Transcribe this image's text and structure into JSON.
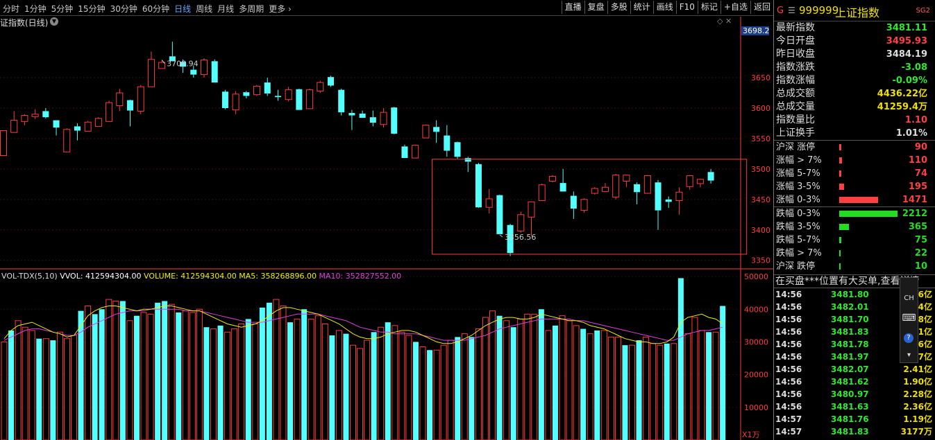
{
  "toolbar": {
    "periods": [
      "分时",
      "1分钟",
      "5分钟",
      "15分钟",
      "30分钟",
      "60分钟",
      "日线",
      "周线",
      "月线",
      "多周期",
      "更多 ›"
    ],
    "active_index": 6,
    "tools": [
      "直播",
      "复盘",
      "多股",
      "统计",
      "画线",
      "F10",
      "标记",
      "+自选",
      "返回"
    ]
  },
  "chart_title": "证指数(日线)",
  "colors": {
    "up": "#ff3c3c",
    "down": "#54ffff",
    "ma5": "#f0f000",
    "ma10": "#e040e0",
    "axis": "#ff3c3c",
    "text_up": "#ff4040",
    "text_down": "#2ee82e"
  },
  "chart_data": [
    {
      "type": "candlestick",
      "title": "证指数(日线)",
      "ylim": [
        3336,
        3732
      ],
      "y_ticks": [
        3350,
        3400,
        3450,
        3500,
        3550,
        3600,
        3650
      ],
      "last_price_label": "3698.2",
      "annotations": [
        {
          "text": "3708.94",
          "index": 15
        },
        {
          "text": "3356.56",
          "index": 47
        }
      ],
      "box": {
        "from_index": 41,
        "to_index": 70,
        "top": 3516,
        "bottom": 3360
      },
      "candles": [
        {
          "o": 3522,
          "h": 3563,
          "l": 3522,
          "c": 3563
        },
        {
          "o": 3560,
          "h": 3595,
          "l": 3560,
          "c": 3580
        },
        {
          "o": 3578,
          "h": 3590,
          "l": 3572,
          "c": 3588
        },
        {
          "o": 3586,
          "h": 3598,
          "l": 3582,
          "c": 3590
        },
        {
          "o": 3595,
          "h": 3600,
          "l": 3583,
          "c": 3585
        },
        {
          "o": 3580,
          "h": 3580,
          "l": 3555,
          "c": 3568
        },
        {
          "o": 3528,
          "h": 3567,
          "l": 3528,
          "c": 3565
        },
        {
          "o": 3570,
          "h": 3575,
          "l": 3547,
          "c": 3563
        },
        {
          "o": 3562,
          "h": 3579,
          "l": 3562,
          "c": 3577
        },
        {
          "o": 3570,
          "h": 3585,
          "l": 3570,
          "c": 3583
        },
        {
          "o": 3578,
          "h": 3612,
          "l": 3578,
          "c": 3609
        },
        {
          "o": 3604,
          "h": 3632,
          "l": 3595,
          "c": 3625
        },
        {
          "o": 3613,
          "h": 3614,
          "l": 3570,
          "c": 3596
        },
        {
          "o": 3595,
          "h": 3638,
          "l": 3590,
          "c": 3635
        },
        {
          "o": 3635,
          "h": 3693,
          "l": 3635,
          "c": 3680
        },
        {
          "o": 3665,
          "h": 3678,
          "l": 3665,
          "c": 3675
        },
        {
          "o": 3685,
          "h": 3709,
          "l": 3680,
          "c": 3677
        },
        {
          "o": 3676,
          "h": 3680,
          "l": 3658,
          "c": 3668
        },
        {
          "o": 3663,
          "h": 3670,
          "l": 3650,
          "c": 3655
        },
        {
          "o": 3655,
          "h": 3682,
          "l": 3650,
          "c": 3679
        },
        {
          "o": 3677,
          "h": 3680,
          "l": 3642,
          "c": 3642
        },
        {
          "o": 3627,
          "h": 3630,
          "l": 3598,
          "c": 3600
        },
        {
          "o": 3597,
          "h": 3628,
          "l": 3590,
          "c": 3623
        },
        {
          "o": 3626,
          "h": 3628,
          "l": 3616,
          "c": 3620
        },
        {
          "o": 3622,
          "h": 3638,
          "l": 3620,
          "c": 3636
        },
        {
          "o": 3642,
          "h": 3650,
          "l": 3620,
          "c": 3624
        },
        {
          "o": 3620,
          "h": 3630,
          "l": 3612,
          "c": 3618
        },
        {
          "o": 3614,
          "h": 3635,
          "l": 3611,
          "c": 3630
        },
        {
          "o": 3631,
          "h": 3632,
          "l": 3597,
          "c": 3597
        },
        {
          "o": 3599,
          "h": 3632,
          "l": 3599,
          "c": 3630
        },
        {
          "o": 3628,
          "h": 3645,
          "l": 3625,
          "c": 3642
        },
        {
          "o": 3651,
          "h": 3653,
          "l": 3635,
          "c": 3637
        },
        {
          "o": 3630,
          "h": 3632,
          "l": 3588,
          "c": 3593
        },
        {
          "o": 3592,
          "h": 3597,
          "l": 3564,
          "c": 3588
        },
        {
          "o": 3591,
          "h": 3596,
          "l": 3584,
          "c": 3584
        },
        {
          "o": 3585,
          "h": 3596,
          "l": 3570,
          "c": 3576
        },
        {
          "o": 3573,
          "h": 3600,
          "l": 3568,
          "c": 3593
        },
        {
          "o": 3601,
          "h": 3602,
          "l": 3557,
          "c": 3558
        },
        {
          "o": 3537,
          "h": 3540,
          "l": 3518,
          "c": 3518
        },
        {
          "o": 3518,
          "h": 3540,
          "l": 3518,
          "c": 3539
        },
        {
          "o": 3551,
          "h": 3573,
          "l": 3551,
          "c": 3572
        },
        {
          "o": 3569,
          "h": 3580,
          "l": 3543,
          "c": 3561
        },
        {
          "o": 3555,
          "h": 3572,
          "l": 3520,
          "c": 3530
        },
        {
          "o": 3544,
          "h": 3545,
          "l": 3517,
          "c": 3520
        },
        {
          "o": 3518,
          "h": 3520,
          "l": 3495,
          "c": 3512
        },
        {
          "o": 3508,
          "h": 3510,
          "l": 3436,
          "c": 3437
        },
        {
          "o": 3437,
          "h": 3467,
          "l": 3427,
          "c": 3451
        },
        {
          "o": 3457,
          "h": 3458,
          "l": 3393,
          "c": 3393
        },
        {
          "o": 3408,
          "h": 3410,
          "l": 3357,
          "c": 3362
        },
        {
          "o": 3398,
          "h": 3430,
          "l": 3395,
          "c": 3425
        },
        {
          "o": 3421,
          "h": 3446,
          "l": 3390,
          "c": 3446
        },
        {
          "o": 3448,
          "h": 3476,
          "l": 3448,
          "c": 3474
        },
        {
          "o": 3480,
          "h": 3490,
          "l": 3478,
          "c": 3488
        },
        {
          "o": 3477,
          "h": 3500,
          "l": 3465,
          "c": 3463
        },
        {
          "o": 3456,
          "h": 3463,
          "l": 3418,
          "c": 3435
        },
        {
          "o": 3432,
          "h": 3452,
          "l": 3428,
          "c": 3450
        },
        {
          "o": 3460,
          "h": 3470,
          "l": 3458,
          "c": 3468
        },
        {
          "o": 3463,
          "h": 3477,
          "l": 3463,
          "c": 3470
        },
        {
          "o": 3454,
          "h": 3492,
          "l": 3450,
          "c": 3490
        },
        {
          "o": 3480,
          "h": 3490,
          "l": 3470,
          "c": 3490
        },
        {
          "o": 3475,
          "h": 3478,
          "l": 3442,
          "c": 3462
        },
        {
          "o": 3460,
          "h": 3490,
          "l": 3460,
          "c": 3489
        },
        {
          "o": 3478,
          "h": 3482,
          "l": 3400,
          "c": 3432
        },
        {
          "o": 3450,
          "h": 3455,
          "l": 3436,
          "c": 3446
        },
        {
          "o": 3448,
          "h": 3470,
          "l": 3425,
          "c": 3462
        },
        {
          "o": 3471,
          "h": 3490,
          "l": 3466,
          "c": 3489
        },
        {
          "o": 3476,
          "h": 3484,
          "l": 3470,
          "c": 3483
        },
        {
          "o": 3495,
          "h": 3500,
          "l": 3476,
          "c": 3481
        }
      ]
    },
    {
      "type": "bar",
      "title": "VOL-TDX(5,10)",
      "ylim": [
        0,
        51500
      ],
      "y_ticks": [
        10000,
        20000,
        30000,
        40000,
        50000
      ],
      "unit_label": "X1万",
      "legend": [
        {
          "name": "VVOL",
          "value": "412594304.00",
          "color": "#ffffff"
        },
        {
          "name": "VOLUME",
          "value": "412594304.00",
          "color": "#f0f000"
        },
        {
          "name": "MA5",
          "value": "358268896.00",
          "color": "#f0f000"
        },
        {
          "name": "MA10",
          "value": "352827552.00",
          "color": "#e040e0"
        }
      ],
      "values": [
        30000,
        33500,
        36500,
        34500,
        33500,
        31000,
        31000,
        30500,
        33000,
        31000,
        32000,
        39500,
        41000,
        38500,
        40000,
        43000,
        42500,
        42500,
        36500,
        38000,
        39000,
        38500,
        42000,
        42500,
        41500,
        39000,
        39500,
        39000,
        40000,
        34500,
        34000,
        35000,
        33000,
        34000,
        35500,
        37000,
        35500,
        40500,
        42000,
        43000,
        41000,
        36000,
        37000,
        40000,
        37000,
        38000,
        35500,
        32000,
        33500,
        32500,
        29000,
        28000,
        30500,
        33000,
        34500,
        36000,
        35000,
        33000,
        32000,
        30000,
        28500,
        27500,
        27500,
        29000,
        30500,
        31500,
        32500,
        31500,
        34000,
        37500,
        39500,
        38000,
        36500,
        34500,
        37000,
        38500,
        38500,
        40000,
        33500,
        35000,
        38000,
        36500,
        35000,
        34000,
        32500,
        33500,
        33500,
        31500,
        31500,
        29000,
        29000,
        30500,
        31500,
        29500,
        29000,
        29500,
        29500,
        49500,
        32500,
        37500,
        33500,
        33000,
        33000,
        41000
      ],
      "ma5": [
        31000,
        33500,
        35000,
        35500,
        36000,
        35000,
        34000,
        33000,
        32500,
        31500,
        32000,
        35000,
        38000,
        39500,
        40500,
        41000,
        41000,
        40500,
        40000,
        39500,
        40000,
        40000,
        40500,
        41000,
        41000,
        40500,
        40000,
        39500,
        39500,
        38500,
        37500,
        36500,
        35500,
        35000,
        34500,
        35000,
        35500,
        36500,
        38000,
        39500,
        40500,
        40500,
        40000,
        39500,
        39000,
        38500,
        37500,
        36500,
        35500,
        34000,
        32500,
        31500,
        31000,
        31000,
        31500,
        32500,
        33000,
        33500,
        33500,
        33000,
        32000,
        31000,
        30000,
        29500,
        29500,
        30000,
        31000,
        32000,
        33500,
        35000,
        36000,
        37000,
        37500,
        37500,
        37000,
        37000,
        37500,
        38500,
        38000,
        37500,
        37000,
        36500,
        36500,
        36000,
        35000,
        34500,
        34000,
        33000,
        32000,
        31000,
        30500,
        30000,
        30000,
        29500,
        29500,
        30000,
        31500,
        36000,
        37500,
        38000,
        38500,
        37500,
        37000,
        35500
      ],
      "ma10": [
        30500,
        31500,
        32500,
        33500,
        34000,
        34000,
        33500,
        33000,
        32500,
        32000,
        32000,
        33000,
        34500,
        35500,
        36500,
        37500,
        38500,
        39000,
        39500,
        39500,
        39500,
        40000,
        40000,
        40000,
        40000,
        40000,
        39500,
        39500,
        39500,
        39000,
        38500,
        38000,
        37500,
        37000,
        36500,
        36000,
        36000,
        36000,
        36500,
        37000,
        37500,
        38000,
        38500,
        38500,
        38500,
        38500,
        38000,
        37500,
        37000,
        36500,
        35500,
        34500,
        34000,
        33500,
        33000,
        33000,
        32500,
        32500,
        32500,
        32500,
        32000,
        31500,
        31000,
        30500,
        30500,
        30500,
        30500,
        31000,
        31500,
        32000,
        33000,
        34000,
        34500,
        35000,
        35500,
        36000,
        36500,
        37000,
        37000,
        37000,
        37000,
        37000,
        36500,
        36500,
        36000,
        35500,
        35000,
        34500,
        34000,
        33500,
        33000,
        32500,
        32000,
        31500,
        31000,
        30500,
        30500,
        31500,
        32500,
        33000,
        33500,
        33500,
        34000,
        34500
      ]
    }
  ],
  "quote": {
    "g": "G",
    "eq": "☰",
    "code": "999999",
    "name": "上证指数",
    "sg": "SG2",
    "rows": [
      {
        "label": "最新指数",
        "value": "3481.11",
        "color": "#2ee82e"
      },
      {
        "label": "今日开盘",
        "value": "3495.93",
        "color": "#ff4040"
      },
      {
        "label": "昨日收盘",
        "value": "3484.19",
        "color": "#dddddd"
      },
      {
        "label": "指数涨跌",
        "value": "-3.08",
        "color": "#2ee82e"
      },
      {
        "label": "指数涨幅",
        "value": "-0.09%",
        "color": "#2ee82e"
      },
      {
        "label": "总成交额",
        "value": "4436.22亿",
        "color": "#f0e000"
      },
      {
        "label": "总成交量",
        "value": "41259.4万",
        "color": "#f0e000"
      },
      {
        "label": "指数量比",
        "value": "1.10",
        "color": "#ff4040"
      },
      {
        "label": "上证换手",
        "value": "1.01%",
        "color": "#dddddd"
      }
    ]
  },
  "breadth_up": [
    {
      "label": "沪深 涨停",
      "value": "90",
      "pct": 0.024
    },
    {
      "label": "涨幅 > 7%",
      "value": "110",
      "pct": 0.03
    },
    {
      "label": "涨幅 5-7%",
      "value": "74",
      "pct": 0.02
    },
    {
      "label": "涨幅 3-5%",
      "value": "195",
      "pct": 0.053
    },
    {
      "label": "涨幅 0-3%",
      "value": "1471",
      "pct": 0.4
    }
  ],
  "breadth_down": [
    {
      "label": "跌幅 0-3%",
      "value": "2212",
      "pct": 0.6
    },
    {
      "label": "跌幅 3-5%",
      "value": "365",
      "pct": 0.099
    },
    {
      "label": "跌幅 5-7%",
      "value": "75",
      "pct": 0.02
    },
    {
      "label": "跌幅 > 7%",
      "value": "22",
      "pct": 0.006
    },
    {
      "label": "沪深 跌停",
      "value": "10",
      "pct": 0.003
    }
  ],
  "ticker_text": "在买盘***位置有大买单,查看详情",
  "ime": {
    "mode": "CH",
    "keyboard": "⌨",
    "help": "?",
    "more": "▾"
  },
  "trades": [
    {
      "time": "14:56",
      "price": "3481.80",
      "amount": "4.36亿"
    },
    {
      "time": "14:56",
      "price": "3482.01",
      "amount": "2.24亿"
    },
    {
      "time": "14:56",
      "price": "3481.70",
      "amount": "2.68亿"
    },
    {
      "time": "14:56",
      "price": "3481.83",
      "amount": "1.81亿"
    },
    {
      "time": "14:56",
      "price": "3481.78",
      "amount": "1.76亿"
    },
    {
      "time": "14:56",
      "price": "3481.97",
      "amount": "1.77亿"
    },
    {
      "time": "14:56",
      "price": "3482.07",
      "amount": "2.41亿"
    },
    {
      "time": "14:56",
      "price": "3481.62",
      "amount": "1.90亿"
    },
    {
      "time": "14:56",
      "price": "3480.97",
      "amount": "2.28亿"
    },
    {
      "time": "14:56",
      "price": "3481.63",
      "amount": "2.36亿"
    },
    {
      "time": "14:57",
      "price": "3481.76",
      "amount": "1.19亿"
    },
    {
      "time": "14:57",
      "price": "3481.83",
      "amount": "3177万"
    }
  ]
}
